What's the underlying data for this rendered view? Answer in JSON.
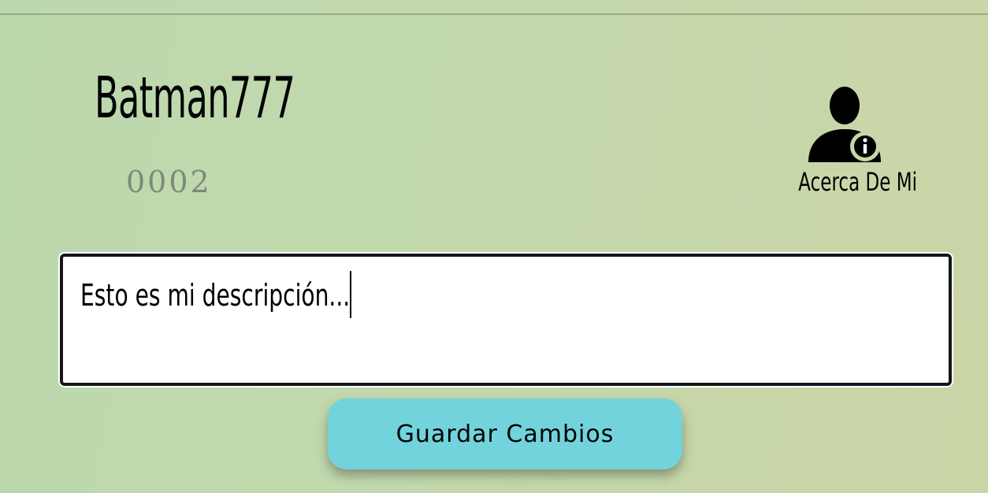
{
  "profile": {
    "username": "Batman777",
    "user_code": "0002"
  },
  "about_me": {
    "icon": "user-info-icon",
    "label": "Acerca De Mi"
  },
  "description": {
    "value": "Esto es mi descripción..."
  },
  "actions": {
    "save_label": "Guardar Cambios",
    "save_color": "#72d3dc"
  },
  "theme": {
    "background_start": "#bcd8ad",
    "background_end": "#cad5a6",
    "code_color": "#7d8a78"
  }
}
